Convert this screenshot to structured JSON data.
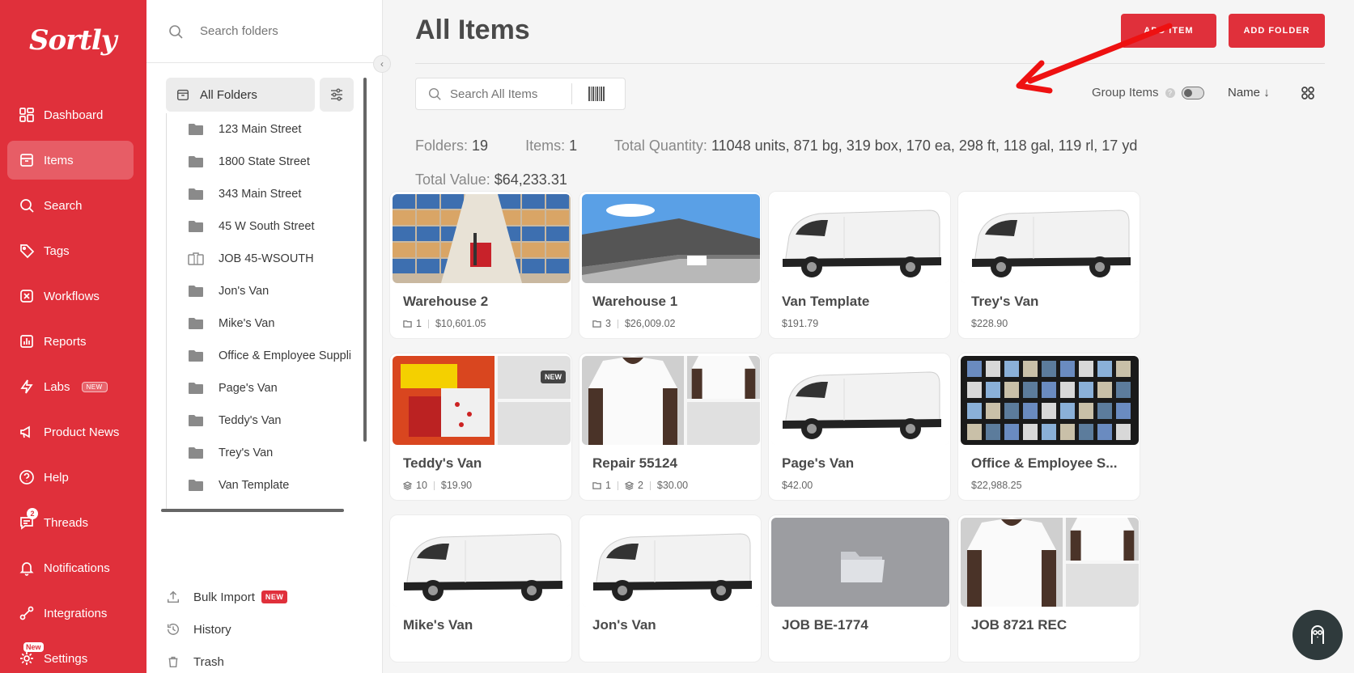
{
  "brand": {
    "logo_text": "Sortly",
    "accent": "#e0303b"
  },
  "nav": {
    "items": [
      {
        "label": "Dashboard",
        "icon": "dashboard-icon"
      },
      {
        "label": "Items",
        "icon": "items-icon",
        "active": true
      },
      {
        "label": "Search",
        "icon": "search-icon"
      },
      {
        "label": "Tags",
        "icon": "tag-icon"
      },
      {
        "label": "Workflows",
        "icon": "workflows-icon"
      },
      {
        "label": "Reports",
        "icon": "reports-icon"
      },
      {
        "label": "Labs",
        "icon": "labs-icon",
        "badge": "NEW"
      },
      {
        "label": "Product News",
        "icon": "megaphone-icon"
      },
      {
        "label": "Help",
        "icon": "help-icon"
      },
      {
        "label": "Threads",
        "icon": "threads-icon",
        "count": "2"
      },
      {
        "label": "Notifications",
        "icon": "bell-icon"
      },
      {
        "label": "Integrations",
        "icon": "integrations-icon"
      },
      {
        "label": "Settings",
        "icon": "gear-icon",
        "badge": "New"
      }
    ]
  },
  "folder_panel": {
    "search_placeholder": "Search folders",
    "all_folders_label": "All Folders",
    "folders": [
      {
        "name": "123 Main Street",
        "icon": "folder-icon"
      },
      {
        "name": "1800 State Street",
        "icon": "folder-icon"
      },
      {
        "name": "343 Main Street",
        "icon": "folder-icon"
      },
      {
        "name": "45 W South Street",
        "icon": "folder-icon"
      },
      {
        "name": "JOB 45-WSOUTH",
        "icon": "briefcase-icon"
      },
      {
        "name": "Jon's Van",
        "icon": "folder-icon"
      },
      {
        "name": "Mike's Van",
        "icon": "folder-icon"
      },
      {
        "name": "Office & Employee Suppli",
        "icon": "folder-icon"
      },
      {
        "name": "Page's Van",
        "icon": "folder-icon"
      },
      {
        "name": "Teddy's Van",
        "icon": "folder-icon"
      },
      {
        "name": "Trey's Van",
        "icon": "folder-icon"
      },
      {
        "name": "Van Template",
        "icon": "folder-icon"
      }
    ],
    "bottom_links": [
      {
        "label": "Bulk Import",
        "icon": "upload-icon",
        "badge": "NEW"
      },
      {
        "label": "History",
        "icon": "history-icon"
      },
      {
        "label": "Trash",
        "icon": "trash-icon"
      }
    ]
  },
  "main": {
    "title": "All Items",
    "add_item_label": "ADD ITEM",
    "add_folder_label": "ADD FOLDER",
    "search_placeholder": "Search All Items",
    "group_items_label": "Group Items",
    "sort_label": "Name",
    "stats": {
      "folders_label": "Folders:",
      "folders_value": "19",
      "items_label": "Items:",
      "items_value": "1",
      "total_quantity_label": "Total Quantity:",
      "total_quantity_value": "11048 units, 871 bg, 319 box, 170 ea, 298 ft, 118 gal, 119 rl, 17 yd",
      "total_value_label": "Total Value:",
      "total_value_value": "$64,233.31"
    },
    "cards": [
      {
        "name": "Warehouse 2",
        "folders": "1",
        "value": "$10,601.05",
        "thumb": "warehouse-interior"
      },
      {
        "name": "Warehouse 1",
        "folders": "3",
        "value": "$26,009.02",
        "thumb": "warehouse-exterior"
      },
      {
        "name": "Van Template",
        "value": "$191.79",
        "thumb": "van"
      },
      {
        "name": "Trey's Van",
        "value": "$228.90",
        "thumb": "van"
      },
      {
        "name": "Teddy's Van",
        "units": "10",
        "value": "$19.90",
        "thumb": "gloves-split",
        "tag": "NEW"
      },
      {
        "name": "Repair 55124",
        "folders": "1",
        "units": "2",
        "value": "$30.00",
        "thumb": "tshirt-split"
      },
      {
        "name": "Page's Van",
        "value": "$42.00",
        "thumb": "van"
      },
      {
        "name": "Office & Employee S...",
        "value": "$22,988.25",
        "thumb": "shelf"
      },
      {
        "name": "Mike's Van",
        "thumb": "van"
      },
      {
        "name": "Jon's Van",
        "thumb": "van"
      },
      {
        "name": "JOB BE-1774",
        "thumb": "empty-folder"
      },
      {
        "name": "JOB 8721 REC",
        "thumb": "tshirt-split"
      }
    ]
  }
}
